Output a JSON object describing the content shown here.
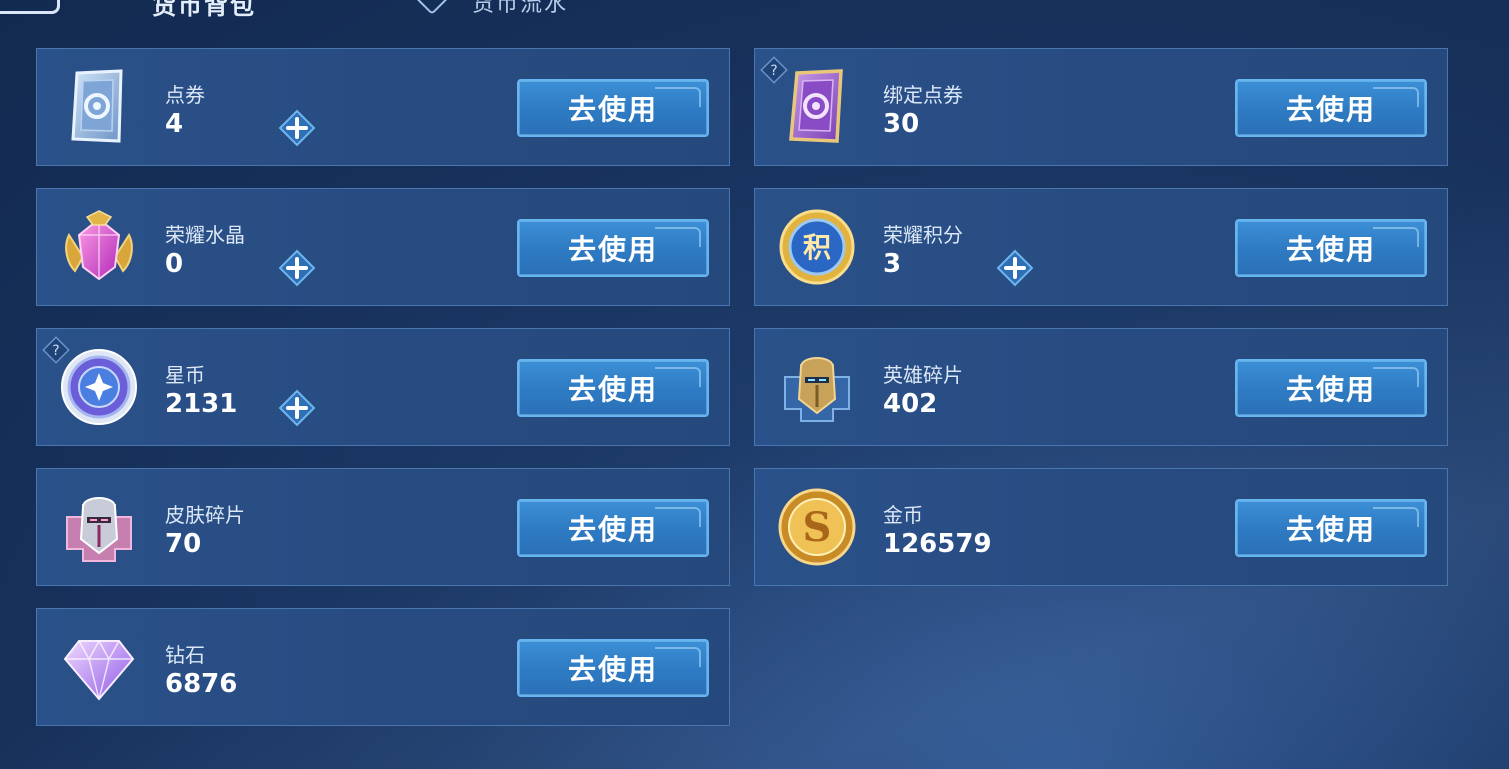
{
  "header": {
    "tab_wallet": "货币背包",
    "tab_flow": "货币流水"
  },
  "use_label": "去使用",
  "cards": [
    {
      "label": "点券",
      "amount": "4",
      "icon": "coupon-card-icon"
    },
    {
      "label": "绑定点券",
      "amount": "30",
      "icon": "bound-coupon-card-icon"
    },
    {
      "label": "荣耀水晶",
      "amount": "0",
      "icon": "glory-crystal-icon"
    },
    {
      "label": "荣耀积分",
      "amount": "3",
      "icon": "glory-points-icon"
    },
    {
      "label": "星币",
      "amount": "2131",
      "icon": "star-coin-icon"
    },
    {
      "label": "英雄碎片",
      "amount": "402",
      "icon": "hero-fragment-icon"
    },
    {
      "label": "皮肤碎片",
      "amount": "70",
      "icon": "skin-fragment-icon"
    },
    {
      "label": "金币",
      "amount": "126579",
      "icon": "gold-coin-icon"
    },
    {
      "label": "钻石",
      "amount": "6876",
      "icon": "diamond-icon"
    }
  ],
  "points_glyph": "积",
  "gold_glyph": "S",
  "colors": {
    "card_bg": "#2a5189",
    "button": "#3c8fd6",
    "button_border": "#63b6f2"
  }
}
